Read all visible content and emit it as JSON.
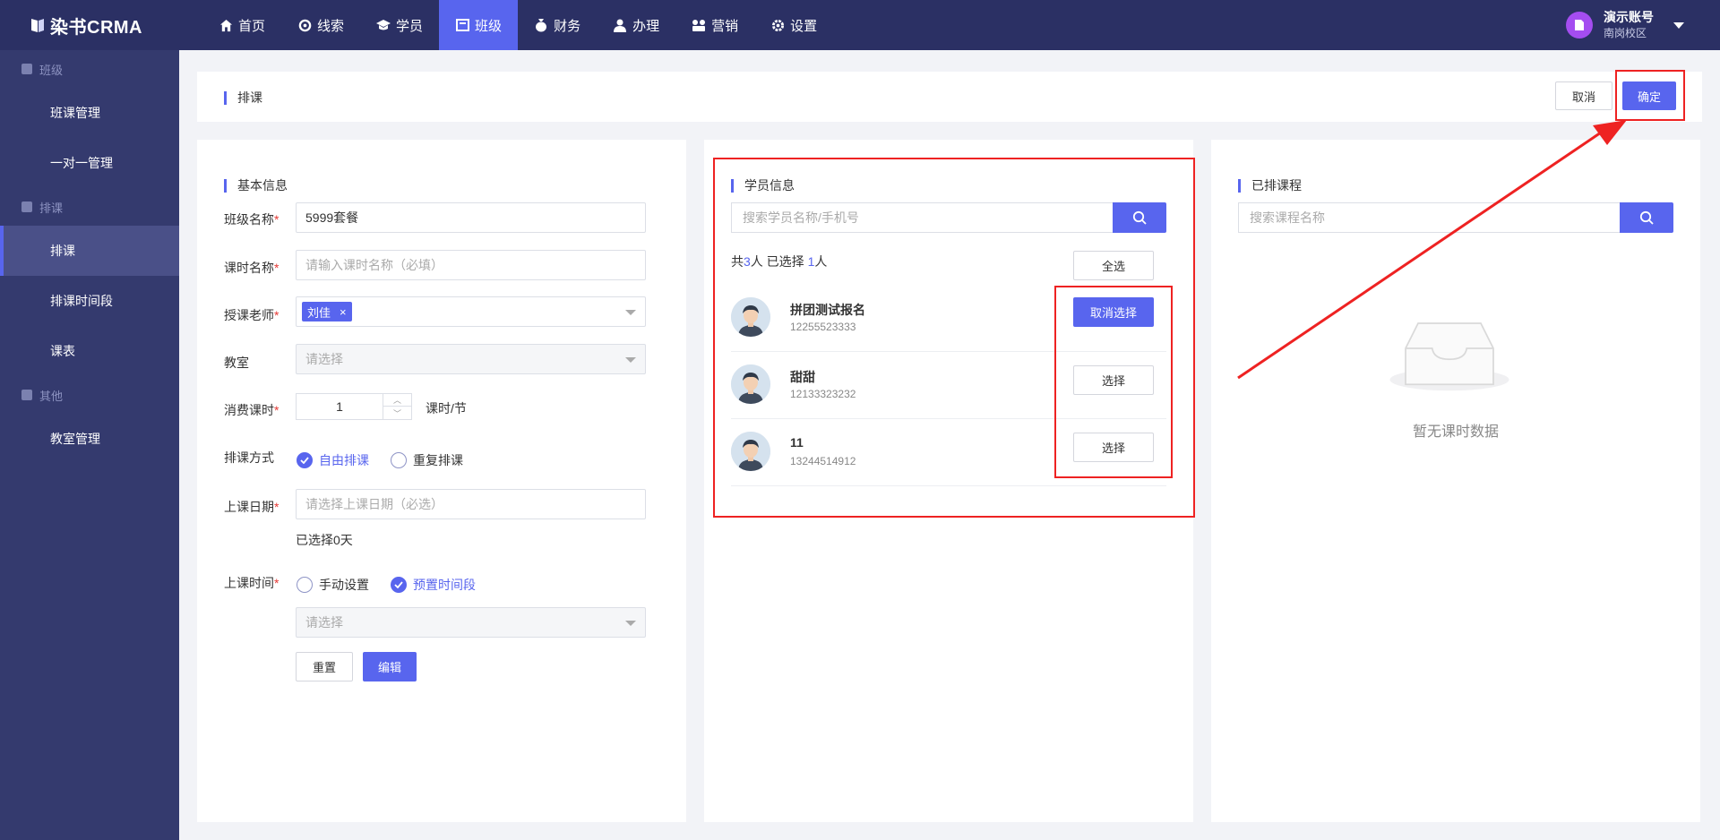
{
  "app": {
    "logo": "染书CRMA"
  },
  "nav": [
    {
      "label": "首页",
      "icon": "home-icon",
      "active": false
    },
    {
      "label": "线索",
      "icon": "leads-icon",
      "active": false
    },
    {
      "label": "学员",
      "icon": "student-icon",
      "active": false
    },
    {
      "label": "班级",
      "icon": "class-icon",
      "active": true
    },
    {
      "label": "财务",
      "icon": "money-bag-icon",
      "active": false
    },
    {
      "label": "办理",
      "icon": "person-icon",
      "active": false
    },
    {
      "label": "营销",
      "icon": "marketing-icon",
      "active": false
    },
    {
      "label": "设置",
      "icon": "gear-icon",
      "active": false
    }
  ],
  "account": {
    "name": "演示账号",
    "campus": "南岗校区"
  },
  "sidebar": {
    "groups": [
      {
        "label": "班级",
        "items": [
          "班课管理",
          "一对一管理"
        ]
      },
      {
        "label": "排课",
        "items": [
          "排课",
          "排课时间段",
          "课表"
        ]
      },
      {
        "label": "其他",
        "items": [
          "教室管理"
        ]
      }
    ],
    "active_item": "排课"
  },
  "header": {
    "title": "排课",
    "cancel_label": "取消",
    "confirm_label": "确定"
  },
  "basic": {
    "title": "基本信息",
    "class_name_label": "班级名称",
    "class_name_value": "5999套餐",
    "lesson_name_label": "课时名称",
    "lesson_name_placeholder": "请输入课时名称（必填）",
    "teacher_label": "授课老师",
    "teacher_tag": "刘佳",
    "teacher_tag_close": "×",
    "room_label": "教室",
    "room_placeholder": "请选择",
    "consume_label": "消费课时",
    "consume_value": "1",
    "consume_unit": "课时/节",
    "mode_label": "排课方式",
    "mode_free": "自由排课",
    "mode_repeat": "重复排课",
    "date_label": "上课日期",
    "date_placeholder": "请选择上课日期（必选）",
    "date_selected": "已选择0天",
    "time_label": "上课时间",
    "time_manual": "手动设置",
    "time_preset": "预置时间段",
    "time_placeholder": "请选择",
    "reset_label": "重置",
    "edit_label": "编辑",
    "required_mark": "*"
  },
  "students": {
    "title": "学员信息",
    "search_placeholder": "搜索学员名称/手机号",
    "summary_prefix": "共",
    "total": "3",
    "summary_mid": "人 已选择 ",
    "selected": "1",
    "summary_suffix": "人",
    "select_all_label": "全选",
    "list": [
      {
        "name": "拼团测试报名",
        "phone": "12255523333",
        "action": "取消选择",
        "selected": true
      },
      {
        "name": "甜甜",
        "phone": "12133323232",
        "action": "选择",
        "selected": false
      },
      {
        "name": "11",
        "phone": "13244514912",
        "action": "选择",
        "selected": false
      }
    ]
  },
  "scheduled": {
    "title": "已排课程",
    "search_placeholder": "搜索课程名称",
    "empty_text": "暂无课时数据"
  },
  "colors": {
    "accent": "#5865ee",
    "nav_bg": "#2b3064",
    "sidebar_bg": "#343a6e",
    "highlight": "#ee2222"
  }
}
